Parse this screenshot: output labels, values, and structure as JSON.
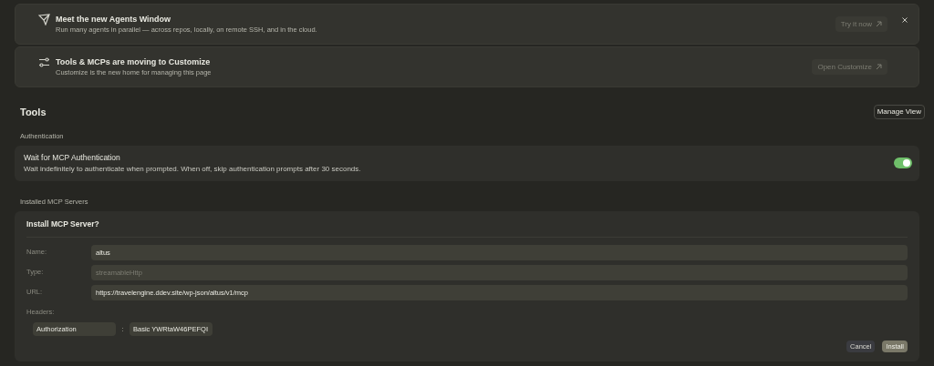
{
  "banners": [
    {
      "kind": "agents",
      "title": "Meet the new Agents Window",
      "description": "Run many agents in parallel — across repos, locally, on remote SSH, and in the cloud.",
      "button": "Try it now",
      "dismissible": true
    },
    {
      "kind": "sliders",
      "title": "Tools & MCPs are moving to Customize",
      "description": "Customize is the new home for managing this page",
      "button": "Open Customize",
      "dismissible": false
    }
  ],
  "section": {
    "title": "Tools",
    "button": "Manage View"
  },
  "authentication": {
    "label": "Authentication",
    "setting": {
      "title": "Wait for MCP Authentication",
      "description": "Wait indefinitely to authenticate when prompted. When off, skip authentication prompts after 30 seconds.",
      "on": true
    }
  },
  "installed": {
    "label": "Installed MCP Servers",
    "dialog": {
      "title": "Install MCP Server?",
      "fields": [
        {
          "label": "Name:",
          "value": "altus"
        },
        {
          "label": "Type:",
          "placeholder": "streamableHttp"
        },
        {
          "label": "URL:",
          "value": "https://travelengine.ddev.site/wp-json/altus/v1/mcp"
        }
      ],
      "headers_label": "Headers:",
      "headers": [
        {
          "key": "Authorization",
          "separator": ":",
          "value": "Basic YWRtaW46PEFQI"
        }
      ],
      "buttons": [
        {
          "label": "Cancel",
          "kind": "secondary"
        },
        {
          "label": "Install",
          "kind": "primary"
        }
      ]
    }
  }
}
